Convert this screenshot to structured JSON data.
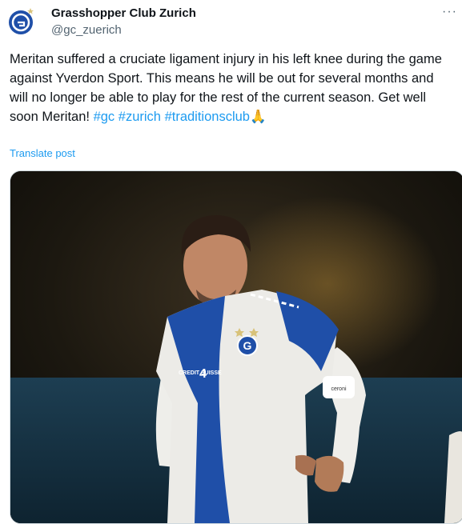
{
  "account": {
    "name": "Grasshopper Club Zurich",
    "handle": "@gc_zuerich",
    "avatar_icon": "gc-club-crest"
  },
  "menu": {
    "more_label": "···"
  },
  "post": {
    "text": "Meritan suffered a cruciate ligament injury in his left knee during the game against Yverdon Sport. This means he will be out for several months and will no longer be able to play for the rest of the current season. Get well soon Meritan! ",
    "hashtags": [
      "#gc",
      "#zurich",
      "#traditionsclub"
    ],
    "emoji": "🙏",
    "translate_label": "Translate post"
  },
  "media": {
    "description_icon": "player-photo",
    "shirt": {
      "crest_text": "G",
      "sponsor": "CREDIT SUISSE",
      "number_mark": "4",
      "armband": "ceroni"
    }
  },
  "colors": {
    "link": "#1d9bf0",
    "muted": "#536471",
    "gc_blue": "#1f4fa8",
    "text": "#0f1419"
  }
}
